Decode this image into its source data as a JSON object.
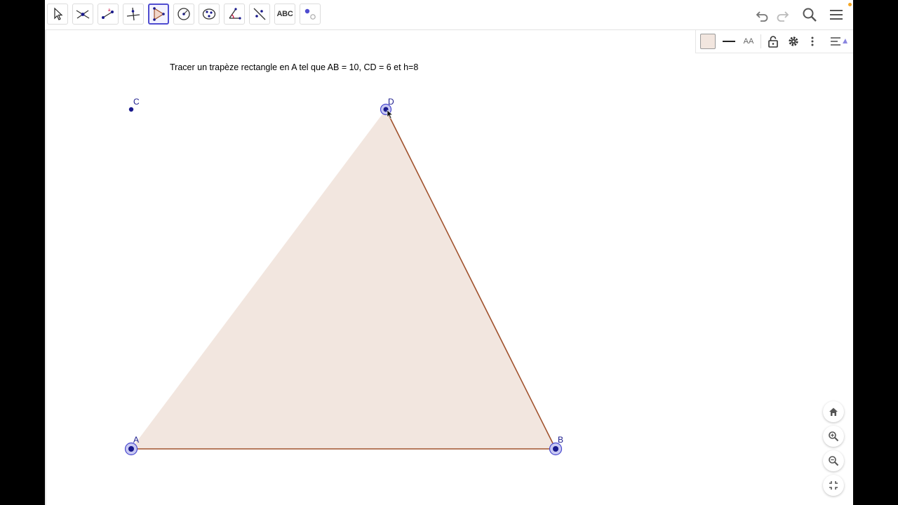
{
  "toolbar": {
    "tools": [
      {
        "name": "move-tool-icon",
        "active": false
      },
      {
        "name": "point-tool-icon",
        "active": false
      },
      {
        "name": "segment-tool-icon",
        "active": false
      },
      {
        "name": "perpendicular-line-tool-icon",
        "active": false
      },
      {
        "name": "polygon-tool-icon",
        "active": true
      },
      {
        "name": "circle-tool-icon",
        "active": false
      },
      {
        "name": "conic-tool-icon",
        "active": false
      },
      {
        "name": "angle-tool-icon",
        "active": false
      },
      {
        "name": "reflect-tool-icon",
        "active": false
      },
      {
        "name": "text-tool-icon",
        "active": false,
        "label": "ABC"
      },
      {
        "name": "slider-tool-icon",
        "active": false
      }
    ],
    "right_icons": [
      "undo-icon",
      "redo-icon",
      "search-icon",
      "menu-icon"
    ],
    "text_tool_label": "ABC"
  },
  "style_bar": {
    "fill_color": "#f2e6df",
    "font_size_label": "AA",
    "icons": [
      "color-swatch-icon",
      "line-style-icon",
      "font-size-icon",
      "lock-icon",
      "settings-icon",
      "more-vertical-icon",
      "toggle-style-bar-icon"
    ]
  },
  "canvas": {
    "task_text": "Tracer un trapèze rectangle en A tel que AB = 10, CD = 6 et h=8",
    "points": {
      "A": {
        "label": "A"
      },
      "B": {
        "label": "B"
      },
      "C": {
        "label": "C"
      },
      "D": {
        "label": "D"
      }
    },
    "polygon_fill": "#f2e6df",
    "edge_color": "#a0522d",
    "point_color": "#1a1a8c"
  },
  "zoom_controls": [
    "home-icon",
    "zoom-in-icon",
    "zoom-out-icon",
    "exit-fullscreen-icon"
  ]
}
